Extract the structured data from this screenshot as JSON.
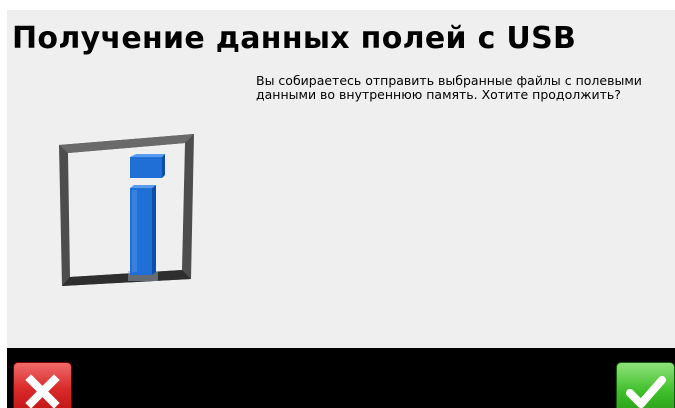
{
  "dialog": {
    "title": "Получение данных полей с USB",
    "message": "Вы собираетесь отправить выбранные файлы с полевыми данными во внутреннюю память. Хотите продолжить?"
  },
  "icons": {
    "info": "info-icon",
    "cancel": "cross-icon",
    "confirm": "checkmark-icon"
  },
  "colors": {
    "background": "#efefef",
    "bottom_bar": "#000000",
    "cancel": "#d92a2a",
    "confirm": "#3fbf2a",
    "info_blue": "#1f6fd6",
    "frame": "#4a4a4a"
  }
}
